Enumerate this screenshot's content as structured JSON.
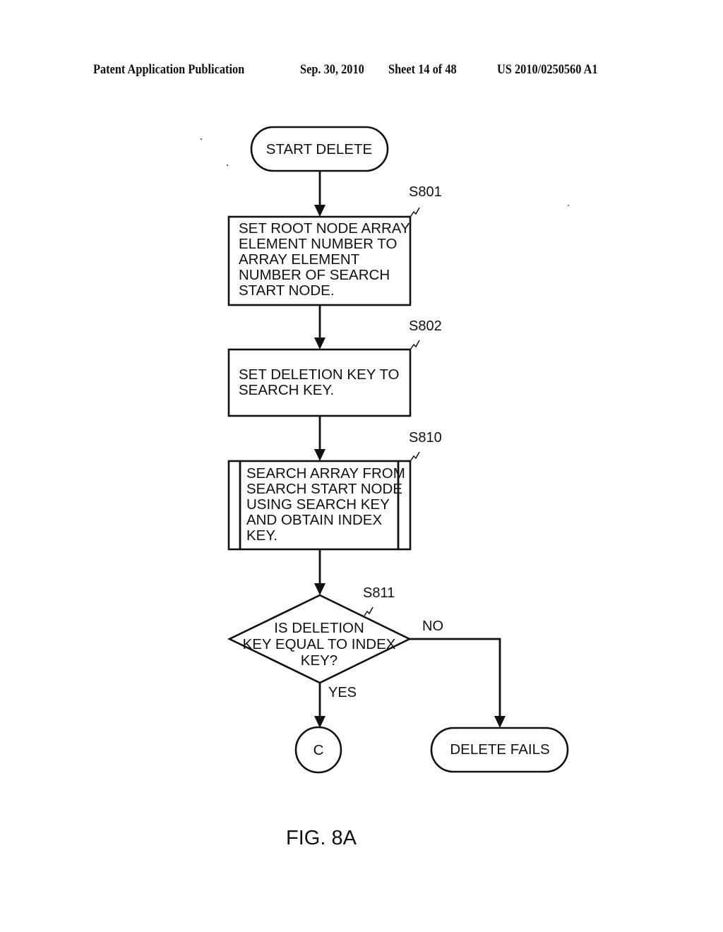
{
  "header": {
    "publication": "Patent Application Publication",
    "date": "Sep. 30, 2010",
    "sheet": "Sheet 14 of 48",
    "number": "US 2010/0250560 A1"
  },
  "flowchart": {
    "start": {
      "text": "START DELETE"
    },
    "steps": [
      {
        "id": "S801",
        "type": "process",
        "lines": [
          "SET ROOT NODE ARRAY",
          "ELEMENT NUMBER TO",
          "ARRAY ELEMENT",
          "NUMBER OF SEARCH",
          "START NODE."
        ]
      },
      {
        "id": "S802",
        "type": "process",
        "lines": [
          "SET DELETION KEY TO",
          "SEARCH KEY."
        ]
      },
      {
        "id": "S810",
        "type": "predefined-process",
        "lines": [
          "SEARCH ARRAY FROM",
          "SEARCH START NODE",
          "USING SEARCH KEY",
          "AND OBTAIN INDEX",
          "KEY."
        ]
      },
      {
        "id": "S811",
        "type": "decision",
        "lines": [
          "IS DELETION",
          "KEY EQUAL TO INDEX",
          "KEY?"
        ],
        "yes_label": "YES",
        "no_label": "NO"
      }
    ],
    "connector": {
      "text": "C"
    },
    "end": {
      "text": "DELETE FAILS"
    }
  },
  "figure_label": "FIG. 8A"
}
